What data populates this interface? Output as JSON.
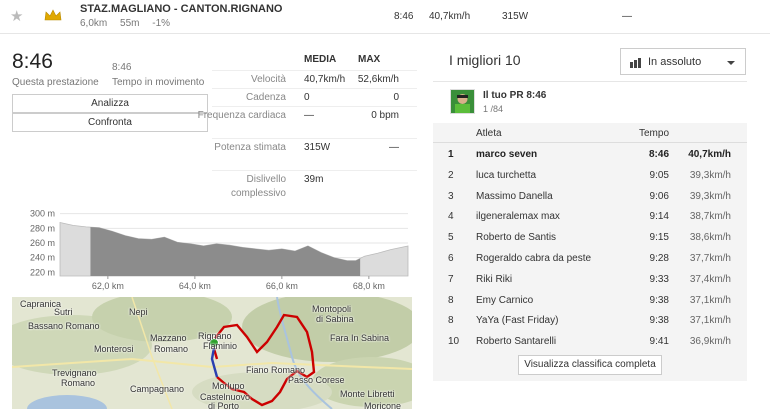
{
  "segment": {
    "name": "STAZ.MAGLIANO - CANTON.RIGNANO",
    "distance": "6,0km",
    "elevation": "55m",
    "grade": "-1%",
    "time": "8:46",
    "speed": "40,7km/h",
    "power": "315W",
    "hr": "—"
  },
  "effort": {
    "time": "8:46",
    "time_label": "Questa prestazione",
    "moving_time": "8:46",
    "moving_label": "Tempo in movimento",
    "analyze_label": "Analizza",
    "compare_label": "Confronta"
  },
  "stats": {
    "header_avg": "MEDIA",
    "header_max": "MAX",
    "rows": [
      {
        "label": "Velocità",
        "avg": "40,7km/h",
        "max": "52,6km/h"
      },
      {
        "label": "Cadenza",
        "avg": "0",
        "max": "0"
      },
      {
        "label": "Frequenza cardiaca",
        "avg": "—",
        "max": "0 bpm"
      },
      {
        "label": "Potenza stimata",
        "avg": "315W",
        "max": "—"
      },
      {
        "label": "Dislivello complessivo",
        "avg": "39m",
        "max": ""
      }
    ]
  },
  "chart_data": {
    "type": "area",
    "title": "",
    "xlabel": "",
    "ylabel": "",
    "y_ticks": [
      "300 m",
      "280 m",
      "260 m",
      "240 m",
      "220 m"
    ],
    "x_ticks": [
      "62,0 km",
      "64,0 km",
      "66,0 km",
      "68,0 km"
    ],
    "ylim": [
      215,
      305
    ],
    "xlim": [
      60.9,
      68.9
    ],
    "highlight_range_km": [
      61.6,
      67.8
    ],
    "series": [
      {
        "x": [
          60.9,
          61.2,
          61.5,
          61.8,
          62.1,
          62.4,
          62.7,
          63.0,
          63.3,
          63.6,
          63.9,
          64.2,
          64.5,
          64.8,
          65.1,
          65.4,
          65.7,
          66.0,
          66.3,
          66.6,
          66.9,
          67.2,
          67.5,
          67.7,
          67.9,
          68.2,
          68.5,
          68.9
        ],
        "y": [
          288,
          284,
          282,
          281,
          276,
          270,
          266,
          265,
          268,
          261,
          259,
          256,
          259,
          257,
          254,
          252,
          250,
          252,
          249,
          256,
          247,
          240,
          236,
          236,
          242,
          246,
          251,
          256
        ]
      }
    ],
    "grid": true
  },
  "map": {
    "labels": [
      {
        "text": "Capranica"
      },
      {
        "text": "Bassano Romano"
      },
      {
        "text": "Sutri"
      },
      {
        "text": "Nepi"
      },
      {
        "text": "Mazzano"
      },
      {
        "text": "Romano"
      },
      {
        "text": "Monterosi"
      },
      {
        "text": "Trevignano"
      },
      {
        "text": "Romano"
      },
      {
        "text": "Campagnano"
      },
      {
        "text": "Rignano"
      },
      {
        "text": "Flaminio"
      },
      {
        "text": "Montopoli"
      },
      {
        "text": "di Sabina"
      },
      {
        "text": "Fara In Sabina"
      },
      {
        "text": "Fiano Romano"
      },
      {
        "text": "Passo Corese"
      },
      {
        "text": "Castelnuovo"
      },
      {
        "text": "di Porto"
      },
      {
        "text": "Morlupo"
      },
      {
        "text": "Monte Libretti"
      },
      {
        "text": "Moricone"
      }
    ]
  },
  "leaderboard": {
    "title": "I migliori 10",
    "filter_label": "In assoluto",
    "pr_title": "Il tuo PR 8:46",
    "pr_rank": "1 /84",
    "col_athlete": "Atleta",
    "col_time": "Tempo",
    "rows": [
      {
        "rank": "1",
        "name": "marco seven",
        "time": "8:46",
        "speed": "40,7km/h"
      },
      {
        "rank": "2",
        "name": "luca turchetta",
        "time": "9:05",
        "speed": "39,3km/h"
      },
      {
        "rank": "3",
        "name": "Massimo Danella",
        "time": "9:06",
        "speed": "39,3km/h"
      },
      {
        "rank": "4",
        "name": "ilgeneralemax max",
        "time": "9:14",
        "speed": "38,7km/h"
      },
      {
        "rank": "5",
        "name": "Roberto de Santis",
        "time": "9:15",
        "speed": "38,6km/h"
      },
      {
        "rank": "6",
        "name": "Rogeraldo cabra da peste",
        "time": "9:28",
        "speed": "37,7km/h"
      },
      {
        "rank": "7",
        "name": "Riki Riki",
        "time": "9:33",
        "speed": "37,4km/h"
      },
      {
        "rank": "8",
        "name": "Emy Carnico",
        "time": "9:38",
        "speed": "37,1km/h"
      },
      {
        "rank": "8",
        "name": "YaYa (Fast Friday)",
        "time": "9:38",
        "speed": "37,1km/h"
      },
      {
        "rank": "10",
        "name": "Roberto Santarelli",
        "time": "9:41",
        "speed": "36,9km/h"
      }
    ],
    "full_label": "Visualizza classifica completa"
  },
  "colors": {
    "crown": "#e0a800",
    "route": "#cc0000",
    "route_highlight": "#2a3fb0",
    "start_marker": "#2aa02a",
    "chart_fill": "#dcdcdc",
    "chart_fill_active": "#8c8c8c"
  }
}
